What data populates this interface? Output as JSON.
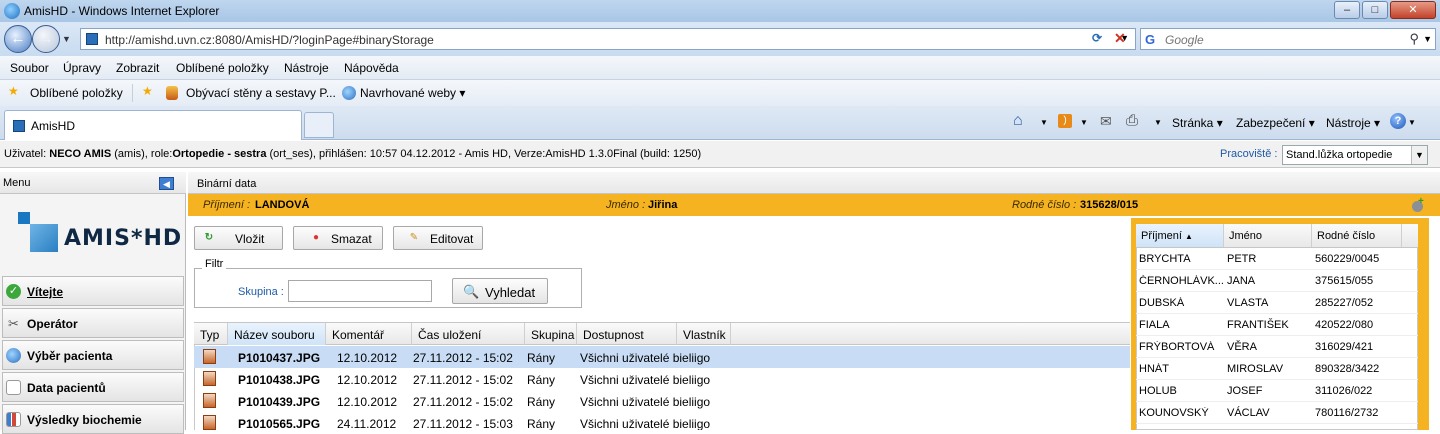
{
  "window": {
    "title": "AmisHD - Windows Internet Explorer",
    "min": "–",
    "max": "□",
    "close": "✕"
  },
  "browser": {
    "url": "http://amishd.uvn.cz:8080/AmisHD/?loginPage#binaryStorage",
    "search_placeholder": "Google",
    "menu": [
      "Soubor",
      "Úpravy",
      "Zobrazit",
      "Oblíbené položky",
      "Nástroje",
      "Nápověda"
    ],
    "favorites": {
      "label": "Oblíbené položky",
      "items": [
        "Obývací stěny a sestavy P...",
        "Navrhované weby ▾"
      ]
    },
    "tab_title": "AmisHD",
    "commands": [
      "Stránka ▾",
      "Zabezpečení ▾",
      "Nástroje ▾"
    ]
  },
  "app": {
    "userline_prefix": "Uživatel: ",
    "user": "NECO AMIS",
    "userline_mid": " (amis), role:",
    "role": "Ortopedie - sestra",
    "userline_rest": " (ort_ses), přihlášen: 10:57 04.12.2012 - Amis HD, Verze:AmisHD 1.3.0Final (build: 1250)",
    "pracoviste_label": "Pracoviště :",
    "pracoviste_value": "Stand.lůžka ortopedie",
    "menu_header": "Menu",
    "logo_text": "AMIS*HD",
    "nav": [
      "Vítejte",
      "Operátor",
      "Výběr pacienta",
      "Data pacientů",
      "Výsledky biochemie"
    ],
    "section_title": "Binární data",
    "patient": {
      "surname_label": "Příjmení :",
      "surname": "LANDOVÁ",
      "name_label": "Jméno :",
      "name": "Jiřina",
      "rc_label": "Rodné číslo :",
      "rc": "315628/015"
    },
    "buttons": {
      "insert": "Vložit",
      "delete": "Smazat",
      "edit": "Editovat"
    },
    "filter": {
      "legend": "Filtr",
      "group_label": "Skupina :",
      "group_value": "",
      "search": "Vyhledat"
    },
    "grid": {
      "columns": [
        "Typ",
        "Název souboru",
        "Komentář",
        "Čas uložení",
        "Skupina",
        "Dostupnost",
        "Vlastník"
      ],
      "rows": [
        {
          "file": "P1010437.JPG",
          "comment": "12.10.2012",
          "saved": "27.11.2012 - 15:02",
          "group": "Rány",
          "access": "Všichni uživatelé bieliigo",
          "owner": ""
        },
        {
          "file": "P1010438.JPG",
          "comment": "12.10.2012",
          "saved": "27.11.2012 - 15:02",
          "group": "Rány",
          "access": "Všichni uživatelé bieliigo",
          "owner": ""
        },
        {
          "file": "P1010439.JPG",
          "comment": "12.10.2012",
          "saved": "27.11.2012 - 15:02",
          "group": "Rány",
          "access": "Všichni uživatelé bieliigo",
          "owner": ""
        },
        {
          "file": "P1010565.JPG",
          "comment": "24.11.2012",
          "saved": "27.11.2012 - 15:03",
          "group": "Rány",
          "access": "Všichni uživatelé bieliigo",
          "owner": ""
        }
      ]
    },
    "patients": {
      "columns": [
        "Příjmení",
        "Jméno",
        "Rodné číslo"
      ],
      "rows": [
        {
          "surname": "BRYCHTA",
          "name": "PETR",
          "rc": "560229/0045"
        },
        {
          "surname": "ČERNOHLÁVK...",
          "name": "JANA",
          "rc": "375615/055"
        },
        {
          "surname": "DUBSKÁ",
          "name": "VLASTA",
          "rc": "285227/052"
        },
        {
          "surname": "FIALA",
          "name": "FRANTIŠEK",
          "rc": "420522/080"
        },
        {
          "surname": "FRÝBORTOVÁ",
          "name": "VĚRA",
          "rc": "316029/421"
        },
        {
          "surname": "HNÁT",
          "name": "MIROSLAV",
          "rc": "890328/3422"
        },
        {
          "surname": "HOLUB",
          "name": "JOSEF",
          "rc": "311026/022"
        },
        {
          "surname": "KOUNOVSKÝ",
          "name": "VÁCLAV",
          "rc": "780116/2732"
        }
      ]
    }
  }
}
